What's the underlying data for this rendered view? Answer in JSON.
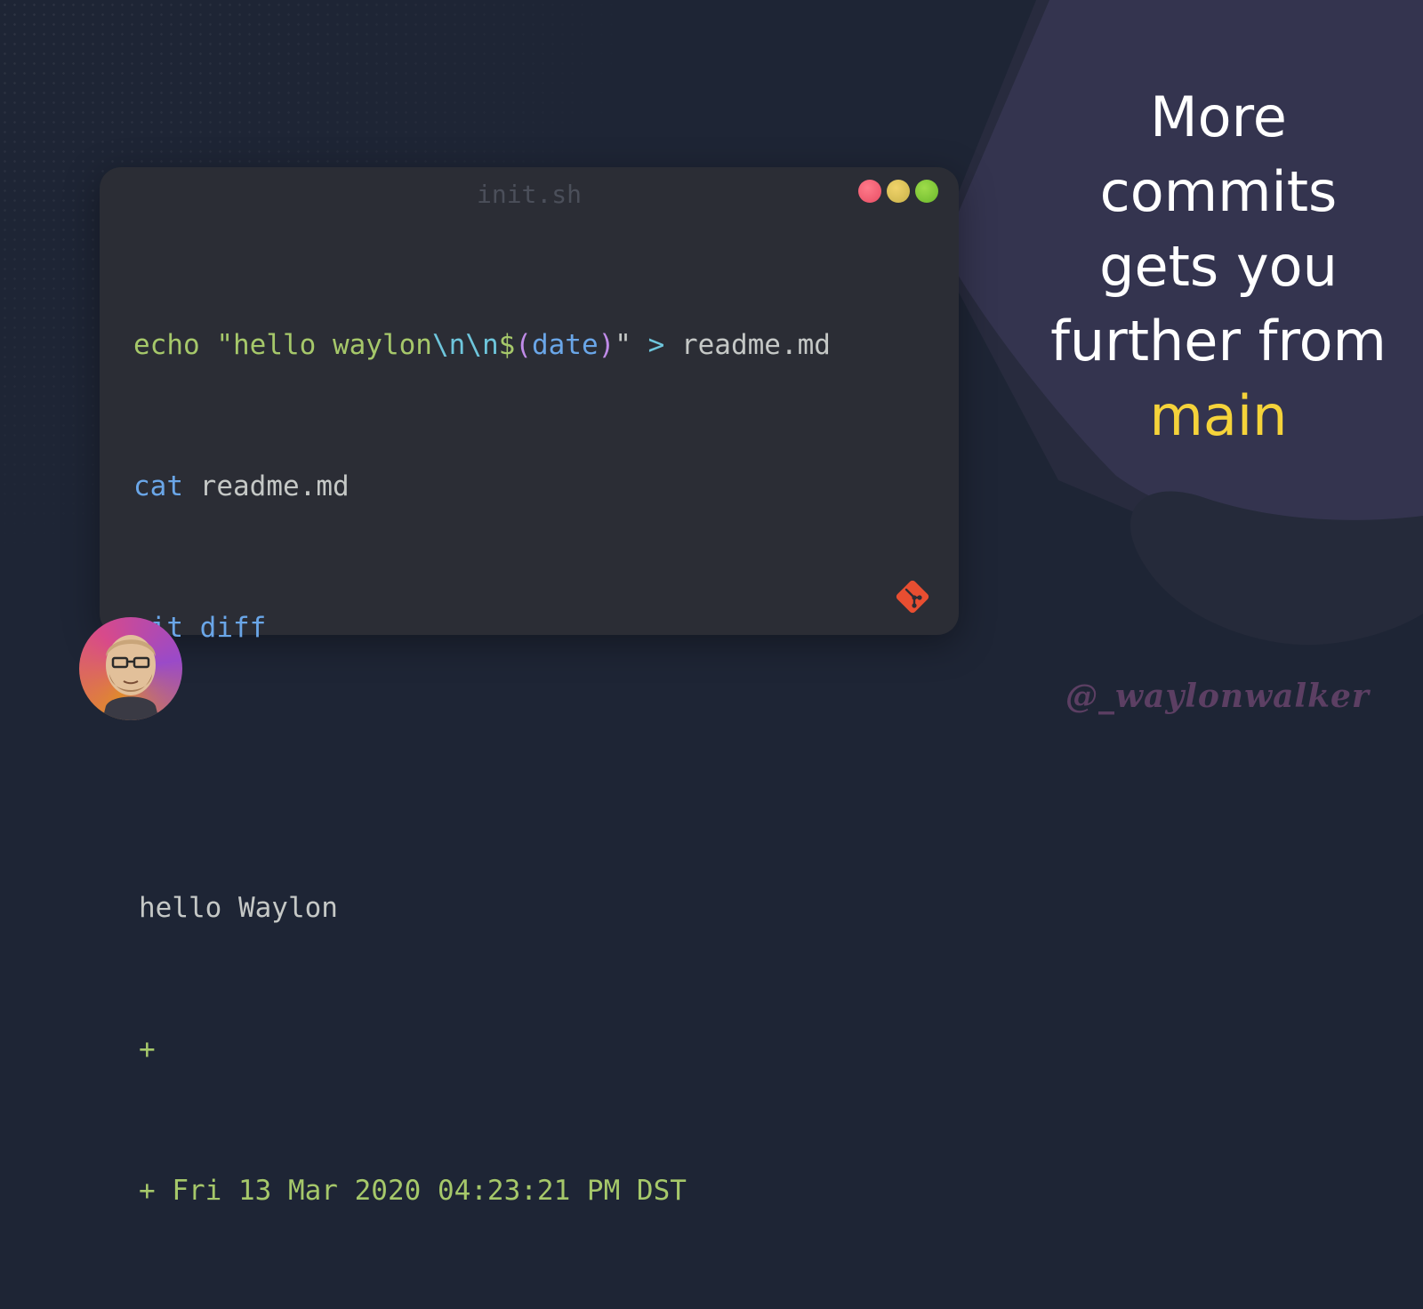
{
  "card": {
    "title": "init.sh",
    "code_lines": [
      {
        "cmd": "echo",
        "str_open": "\"hello waylon",
        "esc": "\\n\\n",
        "dollar": "$",
        "paren_open": "(",
        "var": "date",
        "paren_close": ")",
        "str_close": "\"",
        "redirect": ">",
        "target": "readme.md"
      },
      {
        "cmd": "cat",
        "arg": "readme.md"
      },
      {
        "cmd": "git diff"
      }
    ],
    "output_lines": [
      "hello Waylon",
      "+",
      "+ Fri 13 Mar 2020 04:23:21 PM DST"
    ]
  },
  "headline": {
    "line1": "More",
    "line2": "commits",
    "line3": "gets you",
    "line4": "further from",
    "highlight": "main"
  },
  "handle": "@_waylonwalker",
  "colors": {
    "background": "#1e2535",
    "card": "#2b2d35",
    "panel": "#34344f",
    "accent_yellow": "#f5d33a",
    "git_red": "#e84e31"
  },
  "icons": {
    "window_controls": [
      "red-dot",
      "yellow-dot",
      "green-dot"
    ],
    "git": "git-icon",
    "avatar": "avatar"
  }
}
